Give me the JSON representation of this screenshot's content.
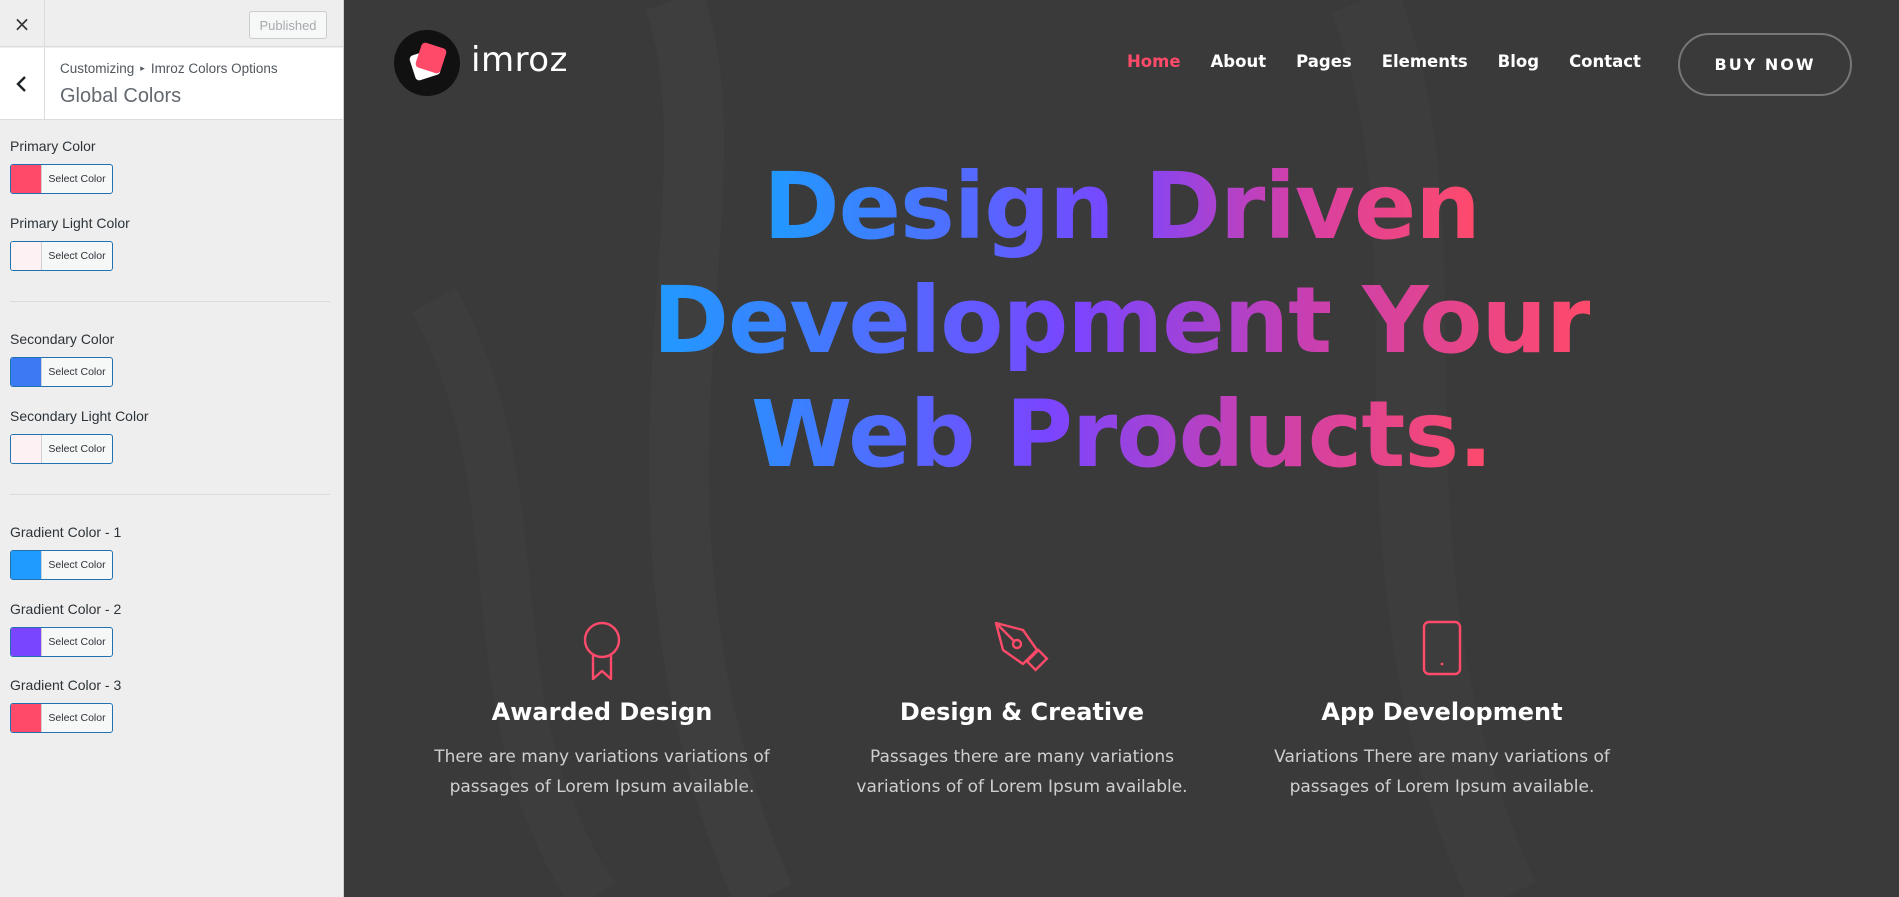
{
  "customizer": {
    "close_icon": "×",
    "published_label": "Published",
    "breadcrumb": {
      "root": "Customizing",
      "separator": "▸",
      "section": "Imroz Colors Options"
    },
    "section_title": "Global Colors",
    "select_color_label": "Select Color",
    "controls": [
      {
        "label": "Primary Color",
        "color": "#ff4a6a"
      },
      {
        "label": "Primary Light Color",
        "color": "#fdf1f3"
      },
      {
        "label": "Secondary Color",
        "color": "#3b7af2"
      },
      {
        "label": "Secondary Light Color",
        "color": "#fdf1f3"
      },
      {
        "label": "Gradient Color - 1",
        "color": "#1f9bff"
      },
      {
        "label": "Gradient Color - 2",
        "color": "#7a45ff"
      },
      {
        "label": "Gradient Color - 3",
        "color": "#ff4a6a"
      }
    ]
  },
  "site": {
    "logo_text": "imroz",
    "nav": [
      "Home",
      "About",
      "Pages",
      "Elements",
      "Blog",
      "Contact"
    ],
    "active_nav": "Home",
    "buy_button": "BUY NOW",
    "hero_lines": [
      "Design Driven",
      "Development Your",
      "Web Products."
    ],
    "features": [
      {
        "icon": "award-ribbon-icon",
        "title": "Awarded Design",
        "text_lines": [
          "There are many variations variations of",
          "passages of Lorem Ipsum available."
        ]
      },
      {
        "icon": "pen-nib-icon",
        "title": "Design & Creative",
        "text_lines": [
          "Passages there are many variations",
          "variations of of Lorem Ipsum available."
        ]
      },
      {
        "icon": "mobile-phone-icon",
        "title": "App Development",
        "text_lines": [
          "Variations There are many variations of",
          "passages of Lorem Ipsum available."
        ]
      }
    ]
  },
  "colors": {
    "accent": "#ff4a6a",
    "preview_bg": "#3a3a3a",
    "sidebar_bg": "#eeeeee",
    "link_blue": "#2271b1"
  }
}
